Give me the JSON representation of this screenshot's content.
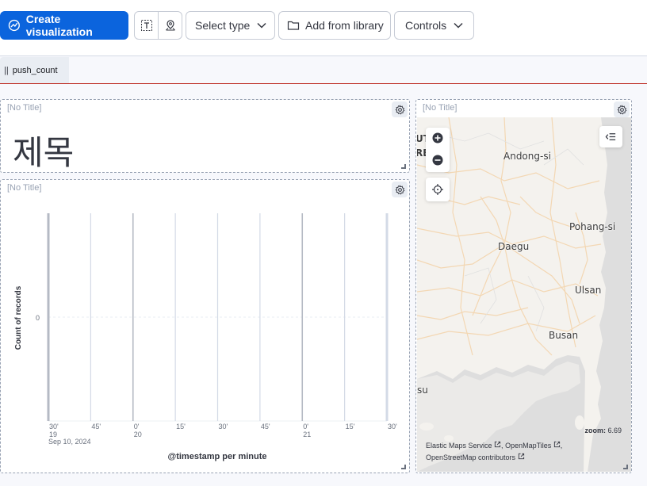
{
  "toolbar": {
    "create_label": "Create visualization",
    "select_type_label": "Select type",
    "add_from_library_label": "Add from library",
    "controls_label": "Controls"
  },
  "controls": {
    "chip_label": "push_count"
  },
  "panels": {
    "markdown": {
      "title": "[No Title]",
      "heading": "제목"
    },
    "chart": {
      "title": "[No Title]"
    },
    "map": {
      "title": "[No Title]",
      "cities": [
        "Andong-si",
        "Pohang-si",
        "Daegu",
        "Ulsan",
        "Busan"
      ],
      "edge_labels": [
        "UT",
        "RE",
        "su"
      ],
      "zoom_label": "zoom:",
      "zoom_value": "6.69",
      "attribution_line1a": "Elastic Maps Service",
      "attribution_line1b": "OpenMapTiles",
      "attribution_line2": "OpenStreetMap contributors"
    }
  },
  "chart_data": {
    "type": "bar",
    "ylabel": "Count of records",
    "xlabel": "@timestamp per minute",
    "y_ticks": [
      "0"
    ],
    "x_ticks": [
      {
        "label": "30'",
        "sub": "19"
      },
      {
        "label": "45'",
        "sub": ""
      },
      {
        "label": "0'",
        "sub": "20"
      },
      {
        "label": "15'",
        "sub": ""
      },
      {
        "label": "30'",
        "sub": ""
      },
      {
        "label": "45'",
        "sub": ""
      },
      {
        "label": "0'",
        "sub": "21"
      },
      {
        "label": "15'",
        "sub": ""
      },
      {
        "label": "30'",
        "sub": ""
      }
    ],
    "date_label": "Sep 10, 2024",
    "values": []
  },
  "colors": {
    "primary": "#0b64dd",
    "danger_line": "#bd271e",
    "panel_border": "#98a2b3"
  }
}
